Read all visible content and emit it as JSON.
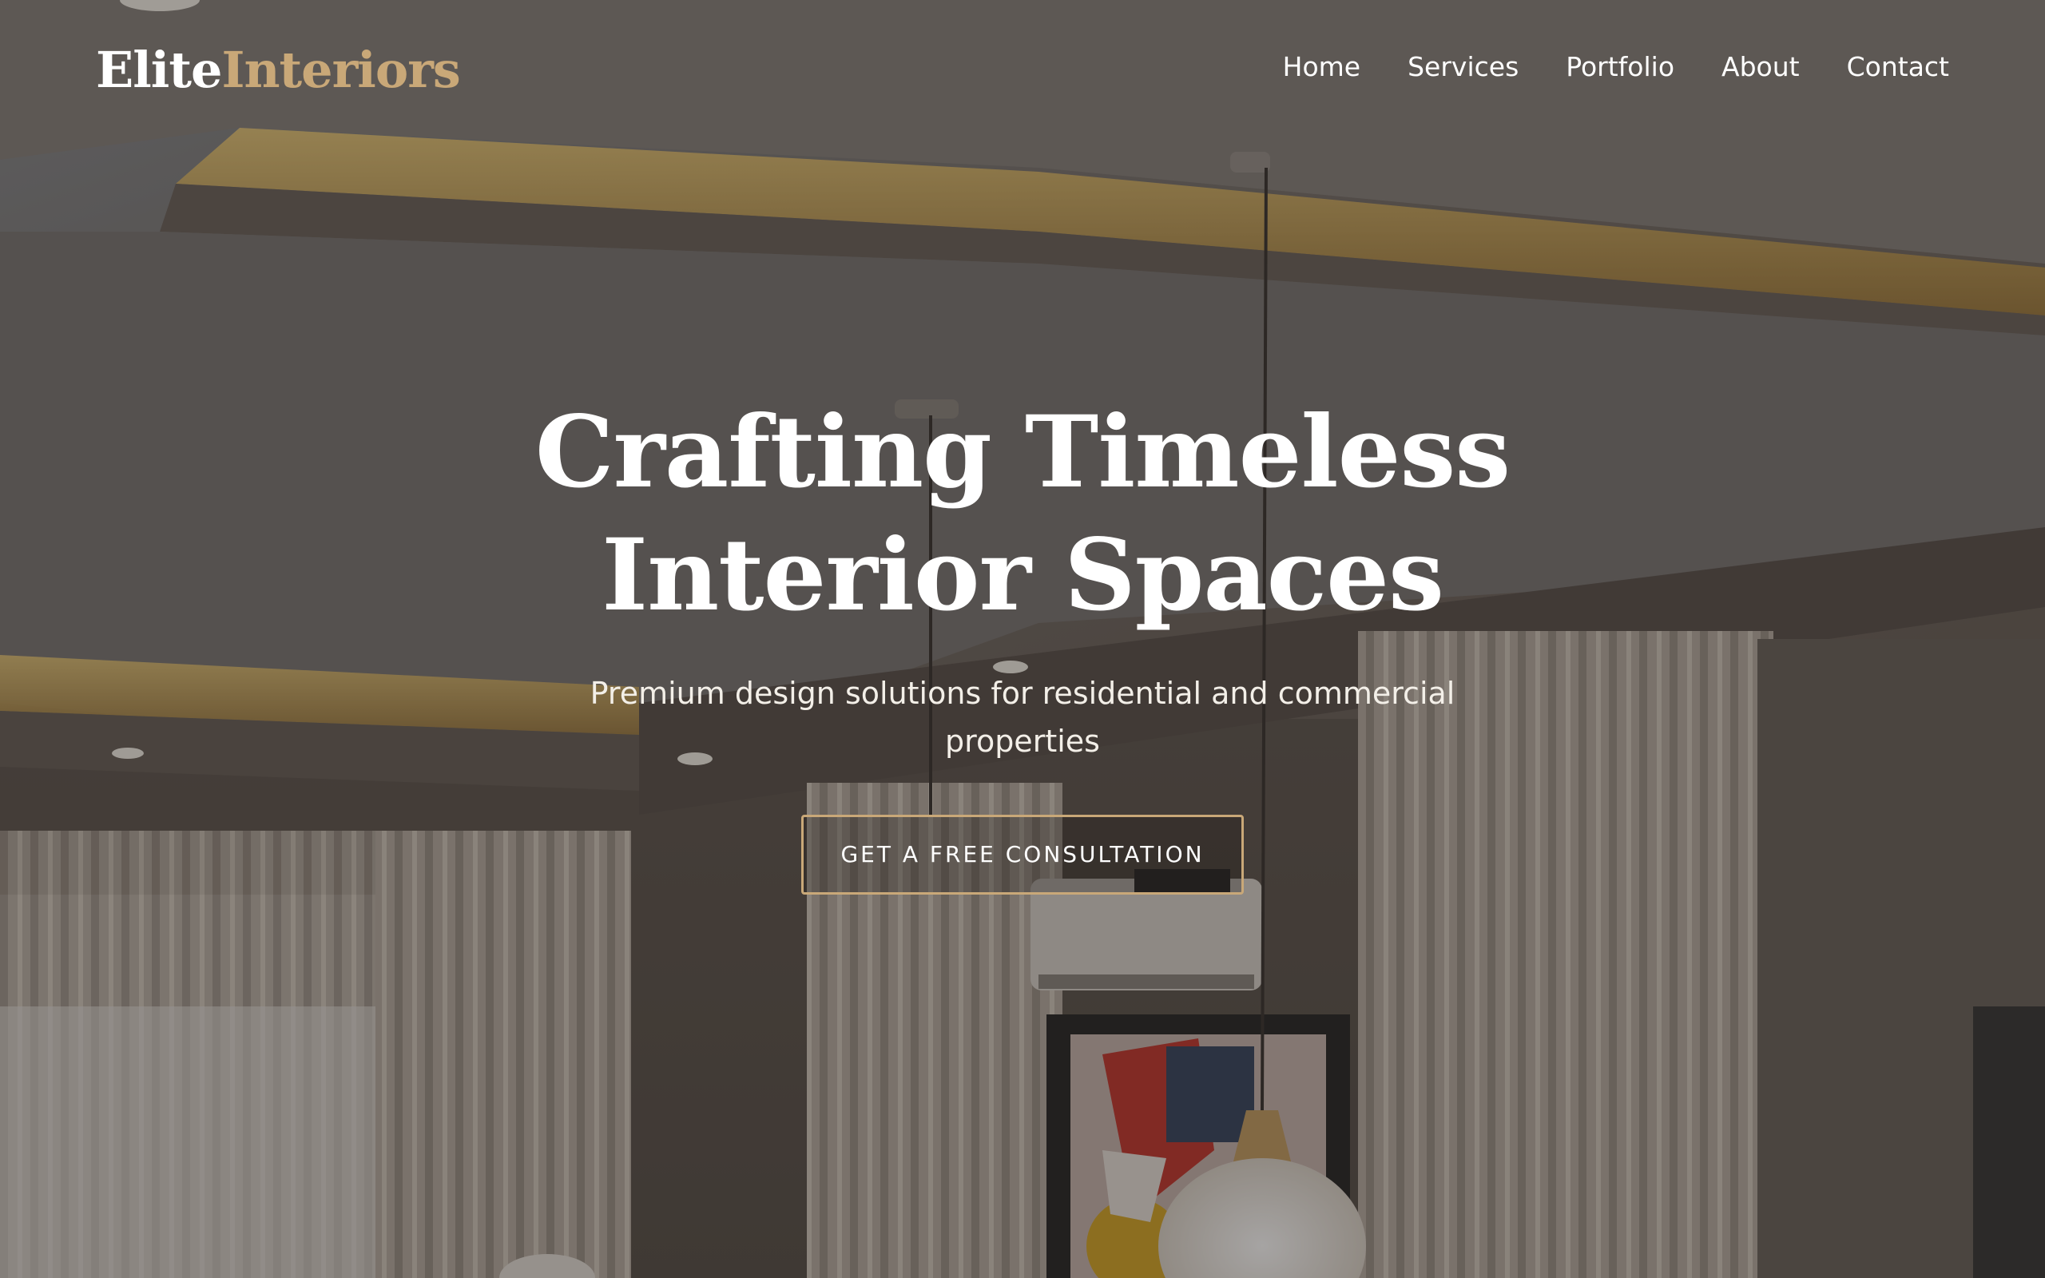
{
  "brand": {
    "name_part1": "Elite",
    "name_part2": "Interiors"
  },
  "nav": {
    "items": [
      {
        "label": "Home"
      },
      {
        "label": "Services"
      },
      {
        "label": "Portfolio"
      },
      {
        "label": "About"
      },
      {
        "label": "Contact"
      }
    ]
  },
  "hero": {
    "title_line1": "Crafting Timeless",
    "title_line2": "Interior Spaces",
    "subtitle": "Premium design solutions for residential and commercial properties",
    "cta_label": "GET A FREE CONSULTATION"
  },
  "colors": {
    "accent_gold": "#c9a878",
    "text_white": "#ffffff"
  }
}
